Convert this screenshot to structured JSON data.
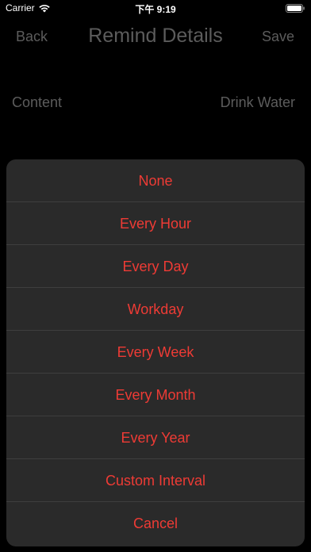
{
  "status_bar": {
    "carrier": "Carrier",
    "time": "下午 9:19",
    "icons": [
      "wifi-icon",
      "battery-icon"
    ]
  },
  "nav": {
    "back_label": "Back",
    "title": "Remind Details",
    "save_label": "Save"
  },
  "content_row": {
    "label": "Content",
    "value": "Drink Water"
  },
  "sheet": {
    "options": [
      "None",
      "Every Hour",
      "Every Day",
      "Workday",
      "Every Week",
      "Every Month",
      "Every Year",
      "Custom Interval",
      "Cancel"
    ]
  },
  "colors": {
    "background": "#000000",
    "sheet_background": "#2a2a2a",
    "accent": "#ee3b35",
    "dimmed_text": "#5c5c5c"
  }
}
